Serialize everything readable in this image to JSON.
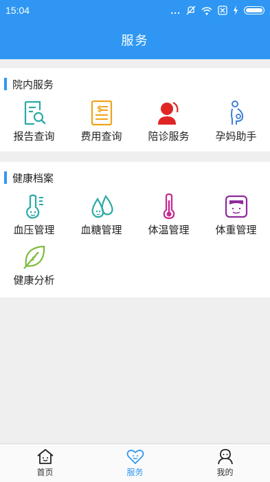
{
  "status_bar": {
    "time": "15:04",
    "dots": "..."
  },
  "header": {
    "title": "服务"
  },
  "sections": [
    {
      "title": "院内服务",
      "items": [
        {
          "label": "报告查询",
          "icon": "report-search-icon",
          "color": "#2aa9a6"
        },
        {
          "label": "费用查询",
          "icon": "bill-icon",
          "color": "#f0a21a"
        },
        {
          "label": "陪诊服务",
          "icon": "companion-icon",
          "color": "#e02525"
        },
        {
          "label": "孕妈助手",
          "icon": "pregnant-icon",
          "color": "#3d7fd6"
        }
      ]
    },
    {
      "title": "健康档案",
      "items": [
        {
          "label": "血压管理",
          "icon": "blood-pressure-icon",
          "color": "#2aa9a6"
        },
        {
          "label": "血糖管理",
          "icon": "blood-sugar-icon",
          "color": "#2aa9a6"
        },
        {
          "label": "体温管理",
          "icon": "thermometer-icon",
          "color": "#c42a8f"
        },
        {
          "label": "体重管理",
          "icon": "scale-icon",
          "color": "#8e2a9a"
        },
        {
          "label": "健康分析",
          "icon": "leaf-icon",
          "color": "#7dbb3a"
        }
      ]
    }
  ],
  "tabs": [
    {
      "label": "首页",
      "icon": "home-icon",
      "active": false
    },
    {
      "label": "服务",
      "icon": "heart-icon",
      "active": true
    },
    {
      "label": "我的",
      "icon": "user-icon",
      "active": false
    }
  ],
  "colors": {
    "primary": "#2f97f3"
  }
}
